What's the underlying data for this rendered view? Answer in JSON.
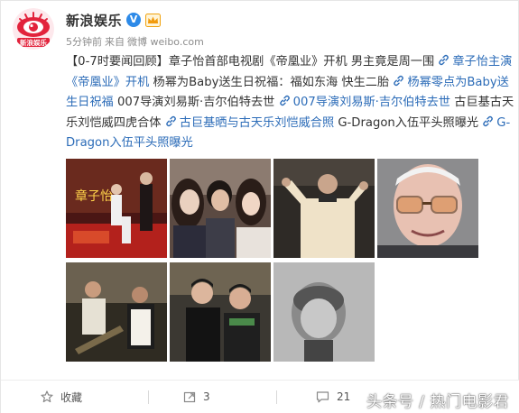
{
  "account": {
    "name": "新浪娱乐",
    "verified_badge": "V",
    "logo_text": "新浪娱乐"
  },
  "meta": {
    "time": "5分钟前",
    "source_prefix": "来自",
    "source": "微博 weibo.com"
  },
  "post": {
    "segments": [
      {
        "type": "text",
        "value": "【0-7时要闻回顾】章子怡首部电视剧《帝凰业》开机 男主竟是周一围 "
      },
      {
        "type": "link",
        "value": "章子怡主演《帝凰业》开机"
      },
      {
        "type": "text",
        "value": " 杨幂为Baby送生日祝福：福如东海 快生二胎 "
      },
      {
        "type": "link",
        "value": "杨幂零点为Baby送生日祝福"
      },
      {
        "type": "text",
        "value": " 007导演刘易斯·吉尔伯特去世 "
      },
      {
        "type": "link",
        "value": "007导演刘易斯·吉尔伯特去世"
      },
      {
        "type": "text",
        "value": " 古巨基古天乐刘恺威四虎合体 "
      },
      {
        "type": "link",
        "value": "古巨基晒与古天乐刘恺威合照"
      },
      {
        "type": "text",
        "value": " G-Dragon入伍平头照曝光 "
      },
      {
        "type": "link",
        "value": "G-Dragon入伍平头照曝光"
      }
    ]
  },
  "images": [
    {
      "icon": "event-photo",
      "desc_label": "章子怡"
    },
    {
      "icon": "group-selfie"
    },
    {
      "icon": "elder-man-gesture"
    },
    {
      "icon": "elder-man-portrait"
    },
    {
      "icon": "film-still"
    },
    {
      "icon": "two-men-photo"
    },
    {
      "icon": "monochrome-portrait"
    }
  ],
  "footer": {
    "favorite_label": "收藏",
    "repost_count": "3",
    "comment_count": "21"
  },
  "watermark": "头条号 / 热门电影君",
  "colors": {
    "link": "#2c6cb8",
    "verified": "#2d8ae8",
    "brand_red": "#e2233c"
  }
}
